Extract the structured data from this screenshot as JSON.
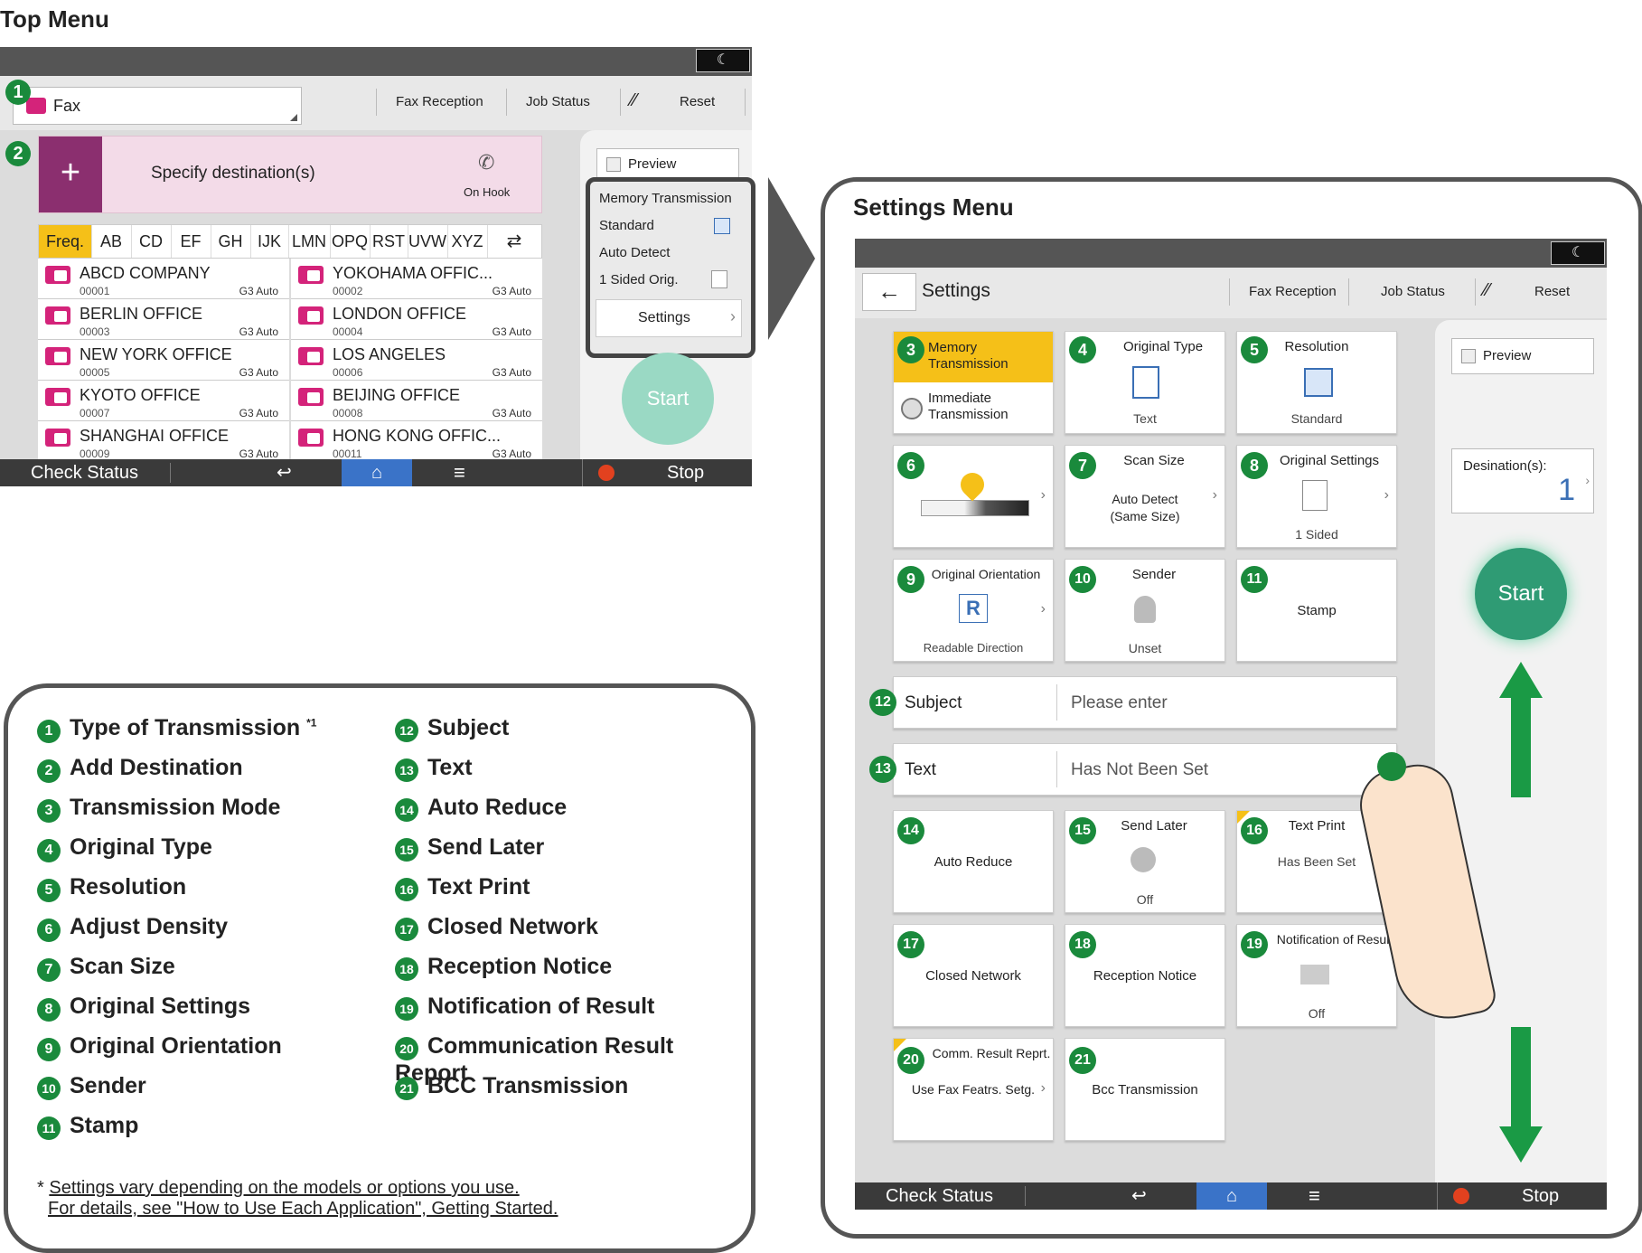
{
  "top_menu": {
    "title": "Top Menu",
    "moon_icon": "☾",
    "fax_selector": "Fax",
    "header_buttons": [
      "Fax Reception",
      "Job Status",
      "Reset"
    ],
    "specify_destination": "Specify destination(s)",
    "on_hook": "On Hook",
    "tabs": [
      "Freq.",
      "AB",
      "CD",
      "EF",
      "GH",
      "IJK",
      "LMN",
      "OPQ",
      "RST",
      "UVW",
      "XYZ"
    ],
    "entries": [
      {
        "name": "ABCD COMPANY",
        "code": "00001",
        "type": "G3 Auto"
      },
      {
        "name": "YOKOHAMA OFFIC...",
        "code": "00002",
        "type": "G3 Auto"
      },
      {
        "name": "BERLIN OFFICE",
        "code": "00003",
        "type": "G3 Auto"
      },
      {
        "name": "LONDON OFFICE",
        "code": "00004",
        "type": "G3 Auto"
      },
      {
        "name": "NEW YORK OFFICE",
        "code": "00005",
        "type": "G3 Auto"
      },
      {
        "name": "LOS ANGELES",
        "code": "00006",
        "type": "G3 Auto"
      },
      {
        "name": "KYOTO OFFICE",
        "code": "00007",
        "type": "G3 Auto"
      },
      {
        "name": "BEIJING OFFICE",
        "code": "00008",
        "type": "G3 Auto"
      },
      {
        "name": "SHANGHAI  OFFICE",
        "code": "00009",
        "type": "G3 Auto"
      },
      {
        "name": "HONG KONG OFFIC...",
        "code": "00011",
        "type": "G3 Auto"
      }
    ],
    "preview": "Preview",
    "settings_summary": [
      "Memory Transmission",
      "Standard",
      "Auto Detect",
      "1 Sided Orig."
    ],
    "settings_button": "Settings",
    "start": "Start",
    "check_status": "Check Status",
    "stop": "Stop"
  },
  "settings_menu": {
    "title": "Settings Menu",
    "settings_label": "Settings",
    "header_buttons": [
      "Fax Reception",
      "Job Status",
      "Reset"
    ],
    "memory_transmission": "Memory\nTransmission",
    "immediate_transmission": "Immediate\nTransmission",
    "original_type": "Original Type",
    "original_type_value": "Text",
    "resolution": "Resolution",
    "resolution_value": "Standard",
    "scan_size": "Scan Size",
    "scan_size_value": "Auto Detect\n(Same Size)",
    "original_settings": "Original Settings",
    "original_settings_value": "1 Sided",
    "original_orientation": "Original Orientation",
    "original_orientation_value": "Readable Direction",
    "sender": "Sender",
    "sender_value": "Unset",
    "stamp": "Stamp",
    "subject": "Subject",
    "subject_value": "Please enter",
    "text": "Text",
    "text_value": "Has Not Been Set",
    "auto_reduce": "Auto Reduce",
    "send_later": "Send Later",
    "send_later_value": "Off",
    "text_print": "Text Print",
    "text_print_value": "Has Been Set",
    "closed_network": "Closed Network",
    "reception_notice": "Reception Notice",
    "notification_of_result": "Notification of Result",
    "notification_value": "Off",
    "comm_result_report": "Comm. Result Reprt.",
    "comm_result_value": "Use Fax Featrs. Setg.",
    "bcc_transmission": "Bcc Transmission",
    "preview": "Preview",
    "destinations_label": "Desination(s):",
    "destinations_count": "1",
    "start": "Start",
    "check_status": "Check Status",
    "stop": "Stop"
  },
  "legend": {
    "left": [
      {
        "n": "1",
        "label": "Type of Transmission",
        "note": "*1"
      },
      {
        "n": "2",
        "label": "Add Destination"
      },
      {
        "n": "3",
        "label": "Transmission Mode"
      },
      {
        "n": "4",
        "label": "Original Type"
      },
      {
        "n": "5",
        "label": "Resolution"
      },
      {
        "n": "6",
        "label": "Adjust Density"
      },
      {
        "n": "7",
        "label": "Scan Size"
      },
      {
        "n": "8",
        "label": "Original Settings"
      },
      {
        "n": "9",
        "label": "Original Orientation"
      },
      {
        "n": "10",
        "label": "Sender"
      },
      {
        "n": "11",
        "label": "Stamp"
      }
    ],
    "right": [
      {
        "n": "12",
        "label": "Subject"
      },
      {
        "n": "13",
        "label": "Text"
      },
      {
        "n": "14",
        "label": "Auto Reduce"
      },
      {
        "n": "15",
        "label": "Send Later"
      },
      {
        "n": "16",
        "label": "Text Print"
      },
      {
        "n": "17",
        "label": "Closed Network"
      },
      {
        "n": "18",
        "label": "Reception Notice"
      },
      {
        "n": "19",
        "label": "Notification of Result"
      },
      {
        "n": "20",
        "label": "Communication Result Report"
      },
      {
        "n": "21",
        "label": "BCC Transmission"
      }
    ],
    "footnote_line1": "Settings vary depending on the models or options you use.",
    "footnote_line2": "For details, see \"How to Use Each Application\", Getting Started.",
    "footnote_marker": "*"
  },
  "colors": {
    "green_badge": "#1a8a3c",
    "accent_magenta": "#8b2f6f",
    "start_teal": "#2f9b74",
    "yellow_selected": "#f5c018"
  }
}
